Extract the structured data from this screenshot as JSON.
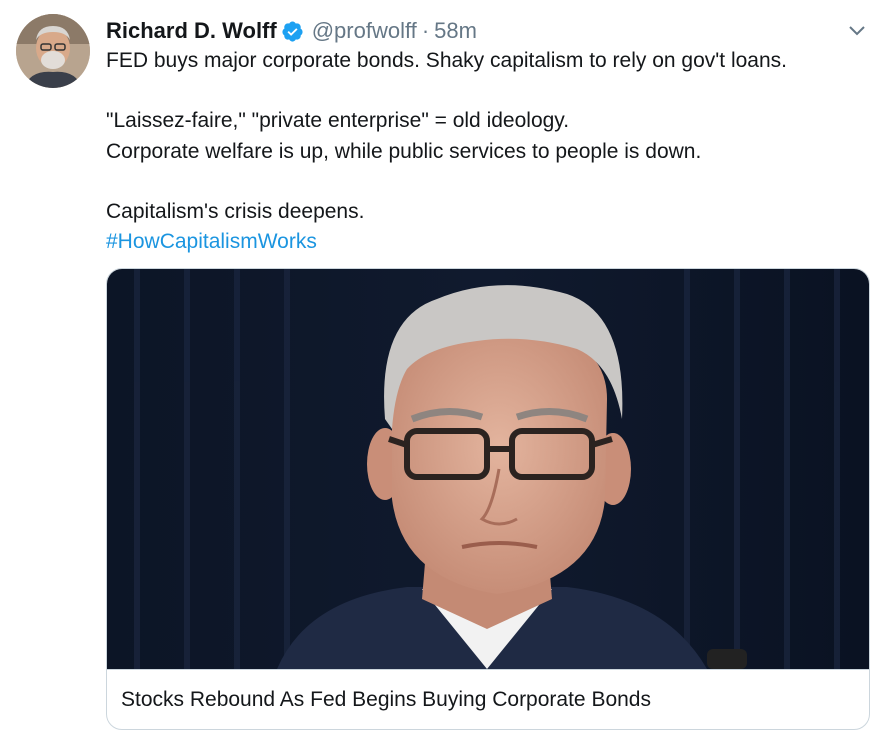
{
  "tweet": {
    "author_name": "Richard D. Wolff",
    "handle": "@profwolff",
    "separator": "·",
    "time": "58m",
    "verified": true,
    "lines": [
      "FED buys major corporate bonds. Shaky capitalism to rely on gov't loans.",
      "\"Laissez-faire,\" \"private enterprise\" = old ideology.",
      "Corporate welfare is up, while public services to people is down.",
      "Capitalism's crisis deepens."
    ],
    "hashtag": "#HowCapitalismWorks"
  },
  "card": {
    "title": "Stocks Rebound As Fed Begins Buying Corporate Bonds"
  },
  "icons": {
    "verified": "verified-badge-icon",
    "caret": "chevron-down-icon"
  },
  "colors": {
    "link": "#1b95e0",
    "verified": "#1da1f2",
    "secondary_text": "#657786",
    "border": "#ccd6dd"
  }
}
